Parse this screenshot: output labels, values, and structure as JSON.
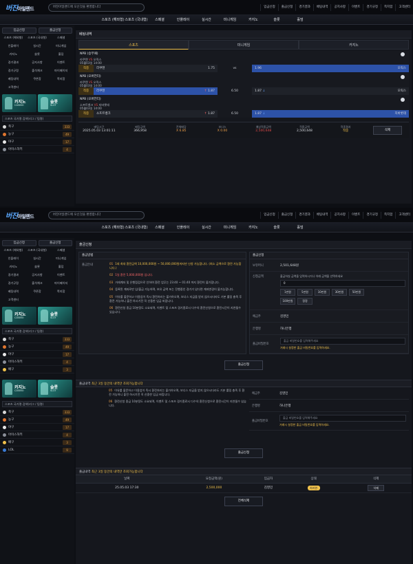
{
  "logo": {
    "main": "버진",
    "sub": "아일랜드"
  },
  "ticker": "버진아일랜드에 오신것을 환영합니다",
  "top_buttons": [
    "입금신청",
    "출금신청",
    "경기결과",
    "베팅내역",
    "공지사항",
    "이벤트",
    "경기규정",
    "쪽지함",
    "고객센터"
  ],
  "ticker2": "버진아일랜드에 오신것을 환영합니다",
  "top_buttons2": [
    "입금신청",
    "출금신청",
    "경기결과",
    "베팅내역",
    "공지사항",
    "이벤트",
    "경기규정",
    "쪽지함",
    "고객센터"
  ],
  "nav": [
    "스포츠 (해외형)",
    "스포츠 (국내형)",
    "스페셜",
    "인플레이",
    "실시간",
    "미니게임",
    "카지노",
    "슬롯",
    "홀덤"
  ],
  "sidebar": {
    "deposit": "입금신청",
    "withdraw": "출금신청",
    "grid": [
      "스포츠 (해외형)",
      "스포츠 (국내형)",
      "스페셜",
      "인플레이",
      "실시간",
      "미니게임",
      "카지노",
      "슬롯",
      "홀덤",
      "경기결과",
      "공지사항",
      "이벤트",
      "경기규정",
      "출석체크",
      "마이페이지",
      "베팅내역",
      "쿠폰함",
      "쪽지함",
      "고객센터"
    ],
    "casino": {
      "title": "카지노",
      "sub": "CASINO"
    },
    "slot": {
      "title": "슬롯",
      "sub": "SLOT"
    },
    "search_placeholder": "스포츠 국가명 검색(리그 / 팀명)",
    "sports": [
      {
        "label": "축구",
        "count": "333",
        "color": "#d9d9d9"
      },
      {
        "label": "농구",
        "count": "49",
        "color": "#e0762f"
      },
      {
        "label": "야구",
        "count": "17",
        "color": "#e8e8e8"
      },
      {
        "label": "아이스하키",
        "count": "4",
        "color": "#8a8f99"
      },
      {
        "label": "배구",
        "count": "3",
        "color": "#f0c14b"
      },
      {
        "label": "LOL",
        "count": "9",
        "color": "#3a7bd5"
      }
    ]
  },
  "betting": {
    "title": "베팅내역",
    "tabs": [
      "스포츠",
      "미니게임",
      "카지노"
    ],
    "games": [
      {
        "league": "NPB (승무패)",
        "teams": [
          "라쿠텐",
          "오릭스"
        ],
        "date": "05월03일 14:00",
        "pick": "적중",
        "home": "라쿠텐",
        "home_odds": "1.75",
        "mid": "vs",
        "away_odds": "1.96",
        "away": "오릭스",
        "hl": "away"
      },
      {
        "league": "NPB (오버언더)",
        "teams": [
          "라쿠텐",
          "오릭스"
        ],
        "date": "05월03일 14:00",
        "pick": "적중",
        "home": "라쿠텐",
        "home_odds": "1.87",
        "mid": "6.50",
        "away_odds": "1.87",
        "away": "오릭스",
        "hl": "home"
      },
      {
        "league": "NPB (오버언더)",
        "teams": [
          "소프트뱅크",
          "지바롯데"
        ],
        "date": "05월03일 14:00",
        "pick": "적중",
        "home": "소프트뱅크",
        "home_odds": "1.87",
        "mid": "6.50",
        "away_odds": "1.87",
        "away": "지바롯데",
        "hl": "away"
      }
    ],
    "summary": {
      "labels": [
        "베팅시간",
        "베팅금액",
        "전체배당",
        "보너스",
        "예상적중금액",
        "적중금액",
        "적중결과"
      ],
      "values": [
        "2025.05.03 13:01:11",
        "366,958",
        "X 6.85",
        "X 0.00",
        "2,500,648",
        "2,500,648",
        "적중"
      ],
      "delete": "삭제"
    }
  },
  "withdraw": {
    "title": "출금신청",
    "left_head": "출금방법",
    "key": "출금안내",
    "notes": [
      {
        "n": "01",
        "t": "1회 최대 환전금액 10,000,000원 ~ 50,000,000원까지만 신청 가능합니다. (최소 금액으로 환전 가능합니다.)"
      },
      {
        "n": "02",
        "t": "1일 환전 5,000,000원 입니다."
      },
      {
        "n": "03",
        "t": "거래계좌 및 은행점검으로 인하여 환전 업무는 23:40 ~ 01:40 까지 환전이 불가합니다."
      },
      {
        "n": "04",
        "t": "등록된 계좌로만 입/출금 가능하며, 보유 금액 또는 진행중인 경기가 있다면 계좌변경이 불가능합니다."
      },
      {
        "n": "05",
        "t": "이유를 불문하고 이용업이 즉시 환전처리는 불가하오며, 보너스 지급을 받지 않으시더라도 기본 롤링 충족 후 환전 가능하니 출전 하시기전 꼭 신중한 입금 바랍니다."
      },
      {
        "n": "06",
        "t": "환전신청 중금 10분정도 소요되며, 이벤트 및 스포츠 경기종료시 다수의 환전신청으로 환전시간이 지연될수 있습니다."
      }
    ],
    "right_head": "출금신청",
    "rows": {
      "balance_label": "보유머니",
      "balance": "2,501,648원",
      "amount_label": "신청금액",
      "amount_hint": "출금하실 금액을 입력하시거나 아래 금액을 선택하세요",
      "amount_value": "0",
      "buttons": [
        "1만원",
        "5만원",
        "10만원",
        "30만원",
        "50만원",
        "100만원",
        "정정"
      ],
      "holder_label": "예금주",
      "holder": "김영민",
      "bank_label": "은행명",
      "bank": "하나은행",
      "pw_label": "출금비밀번호",
      "pw_placeholder": "출금 비밀번호를 입력해주세요",
      "pw_warn": "거래시 설정한 출금 비밀번호를 입력하세요."
    },
    "submit": "출금신청",
    "recent": "최근 3일 동안의 내역만 조회가능합니다",
    "recent_label": "출금내역",
    "table": {
      "headers": [
        "날짜",
        "요청금액(원)",
        "입금자",
        "상태",
        "삭제"
      ],
      "rows": [
        {
          "date": "25.05.03 17:30",
          "amount": "2,500,000",
          "name": "김영민",
          "status": "처리완",
          "del": "삭제"
        }
      ]
    },
    "delete_all": "전체삭제"
  }
}
